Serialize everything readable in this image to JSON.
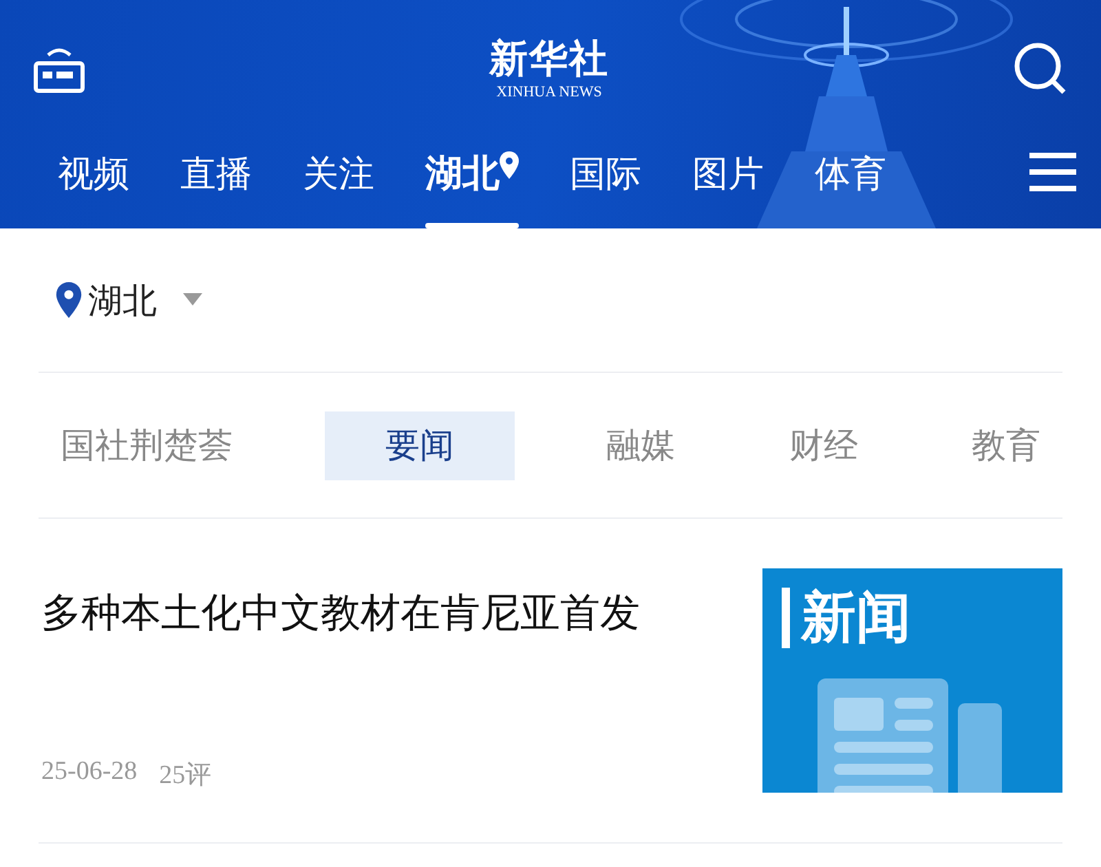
{
  "header": {
    "logo_title": "新华社",
    "logo_subtitle": "XINHUA NEWS"
  },
  "channels": [
    {
      "label": "视频",
      "selected": false,
      "has_pin": false
    },
    {
      "label": "直播",
      "selected": false,
      "has_pin": false
    },
    {
      "label": "关注",
      "selected": false,
      "has_pin": false
    },
    {
      "label": "湖北",
      "selected": true,
      "has_pin": true
    },
    {
      "label": "国际",
      "selected": false,
      "has_pin": false
    },
    {
      "label": "图片",
      "selected": false,
      "has_pin": false
    },
    {
      "label": "体育",
      "selected": false,
      "has_pin": false
    }
  ],
  "location": {
    "label": "湖北"
  },
  "subtabs": [
    {
      "label": "国社荆楚荟",
      "selected": false
    },
    {
      "label": "要闻",
      "selected": true
    },
    {
      "label": "融媒",
      "selected": false
    },
    {
      "label": "财经",
      "selected": false
    },
    {
      "label": "教育",
      "selected": false
    }
  ],
  "articles": [
    {
      "title": "多种本土化中文教材在肯尼亚首发",
      "date": "25-06-28",
      "comments": "25评",
      "thumbnail_label": "新闻"
    }
  ]
}
